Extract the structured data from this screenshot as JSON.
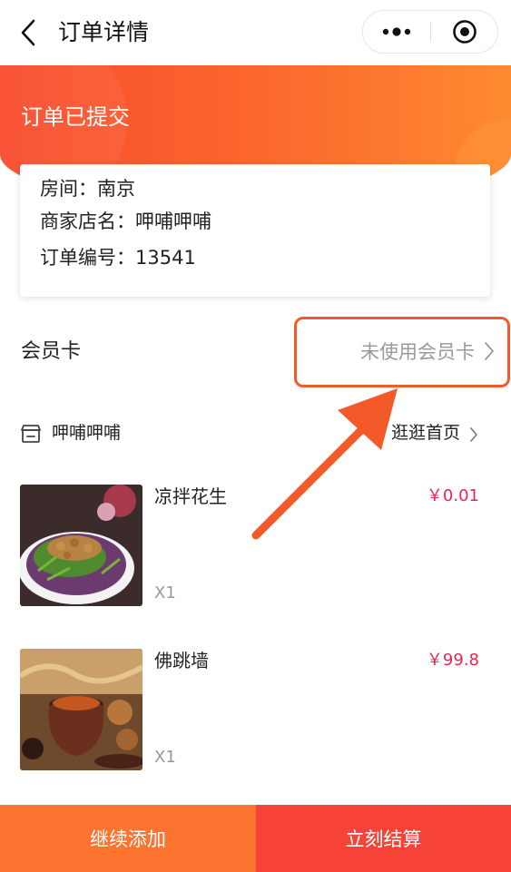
{
  "nav": {
    "title": "订单详情"
  },
  "banner": {
    "status": "订单已提交"
  },
  "info": {
    "room_label": "房间：",
    "room_value": "南京",
    "shop_label": "商家店名：",
    "shop_value": "呷哺呷哺",
    "order_label": "订单编号：",
    "order_value": "13541"
  },
  "member": {
    "label": "会员卡",
    "action": "未使用会员卡"
  },
  "shop": {
    "name": "呷哺呷哺",
    "home_link": "逛逛首页"
  },
  "items": [
    {
      "name": "凉拌花生",
      "qty": "X1",
      "price": "￥0.01"
    },
    {
      "name": "佛跳墙",
      "qty": "X1",
      "price": "￥99.8"
    }
  ],
  "bottom": {
    "continue_label": "继续添加",
    "checkout_label": "立刻结算"
  },
  "colors": {
    "accent": "#fb6a2d",
    "price": "#e8254f",
    "continue_bg": "#fd7431",
    "checkout_bg": "#f64237"
  }
}
